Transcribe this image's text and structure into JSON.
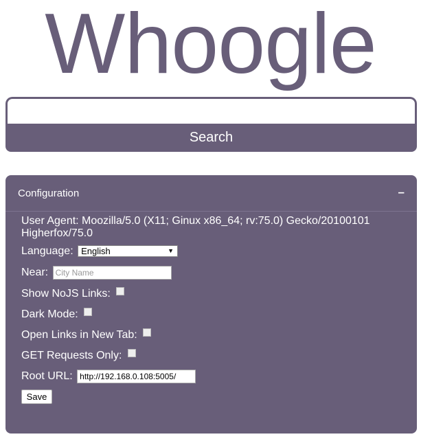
{
  "logo": {
    "text": "Whoogle"
  },
  "search": {
    "value": "",
    "button_label": "Search"
  },
  "config": {
    "title": "Configuration",
    "toggle": "–",
    "user_agent": "User Agent: Moozilla/5.0 (X11; Ginux x86_64; rv:75.0) Gecko/20100101 Higherfox/75.0",
    "language_label": "Language:",
    "language_value": "English",
    "near_label": "Near:",
    "near_placeholder": "City Name",
    "nojs_label": "Show NoJS Links:",
    "dark_label": "Dark Mode:",
    "newtab_label": "Open Links in New Tab:",
    "get_label": "GET Requests Only:",
    "root_label": "Root URL:",
    "root_value": "http://192.168.0.108:5005/",
    "save_label": "Save"
  },
  "colors": {
    "primary": "#685e79",
    "text_on_primary": "#ffffff"
  }
}
